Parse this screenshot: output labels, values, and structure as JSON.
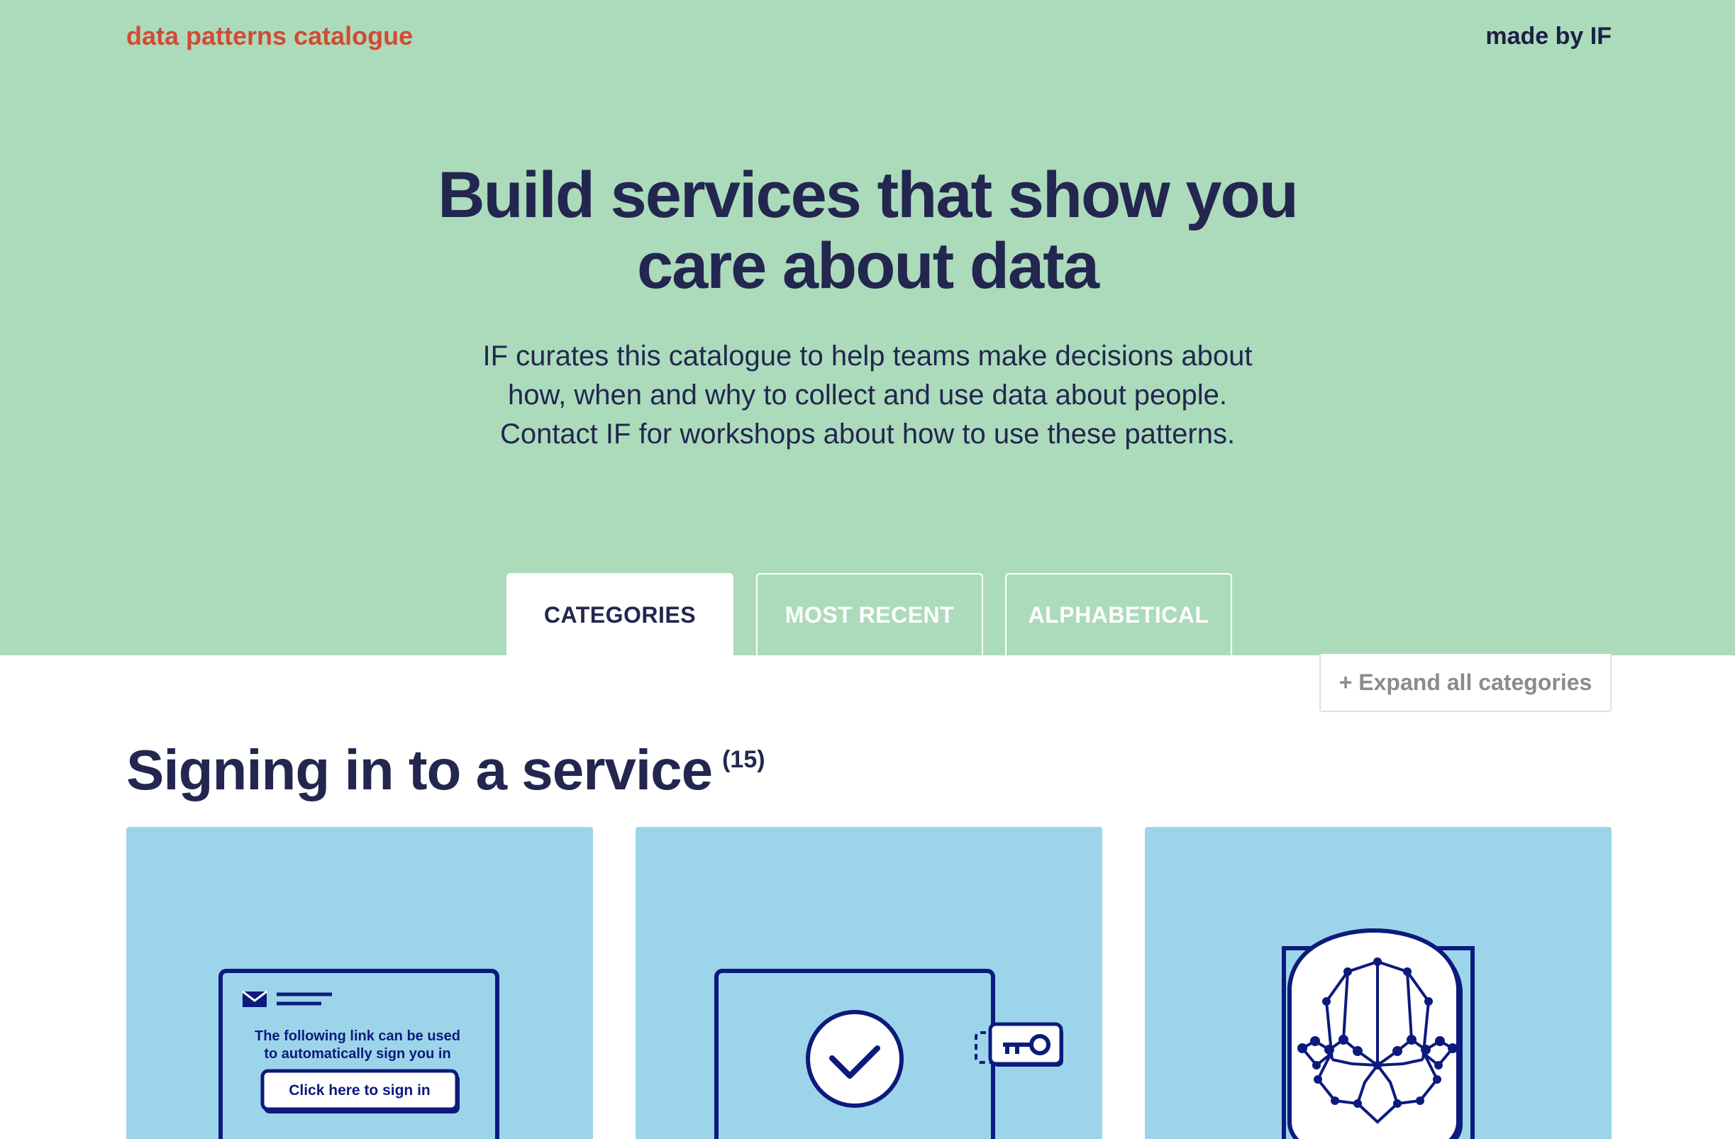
{
  "header": {
    "brand": "data patterns catalogue",
    "made_by": "made by IF"
  },
  "hero": {
    "title_line1": "Build services that show you",
    "title_line2": "care about data",
    "desc_line1": "IF curates this catalogue to help teams make decisions about",
    "desc_line2": "how, when and why to collect and use data about people.",
    "desc_line3": "Contact IF for workshops about how to use these patterns."
  },
  "tabs": [
    {
      "label": "CATEGORIES",
      "active": true
    },
    {
      "label": "MOST RECENT",
      "active": false
    },
    {
      "label": "ALPHABETICAL",
      "active": false
    }
  ],
  "expand_label": "+ Expand all categories",
  "section": {
    "title": "Signing in to a service",
    "count": "(15)"
  },
  "cards": [
    {
      "icon": "email-link-icon",
      "line1": "The following link can be used",
      "line2": "to automatically sign you in",
      "button": "Click here to sign in"
    },
    {
      "icon": "password-manager-icon"
    },
    {
      "icon": "face-recognition-icon"
    }
  ],
  "colors": {
    "hero_bg": "#abdbbb",
    "brand": "#d24a34",
    "text": "#23264f",
    "card_bg": "#9cd5e9",
    "illustration": "#0c1a7d"
  }
}
